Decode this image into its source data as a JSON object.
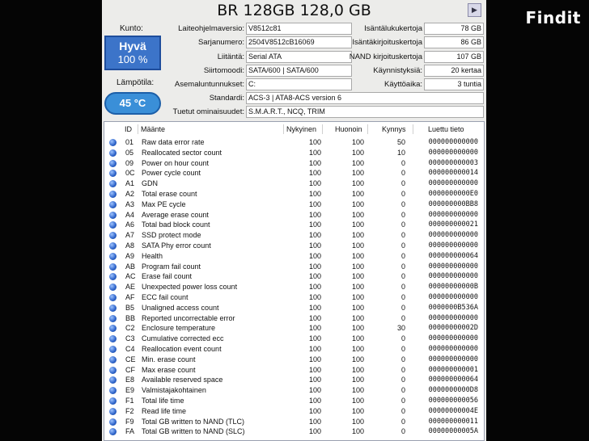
{
  "brand": "Findit",
  "title": "BR 128GB 128,0 GB",
  "left_panel": {
    "condition_label": "Kunto:",
    "condition_value": "Hyvä",
    "condition_percent": "100 %",
    "temperature_label": "Lämpötila:",
    "temperature_value": "45 °C"
  },
  "info": {
    "firmware_label": "Laiteohjelmaversio:",
    "firmware": "V8512c81",
    "serial_label": "Sarjanumero:",
    "serial": "2504V8512cB16069",
    "interface_label": "Liitäntä:",
    "interface": "Serial ATA",
    "transfer_label": "Siirtomoodi:",
    "transfer": "SATA/600 | SATA/600",
    "drive_label": "Asemaluntunnukset:",
    "drive": "C:",
    "standard_label": "Standardi:",
    "standard": "ACS-3 | ATA8-ACS version 6",
    "features_label": "Tuetut ominaisuudet:",
    "features": "S.M.A.R.T., NCQ, TRIM",
    "host_reads_label": "Isäntälukukertoja",
    "host_reads": "78 GB",
    "host_writes_label": "Isäntäkirjoituskertoja",
    "host_writes": "86 GB",
    "nand_writes_label": "NAND kirjoituskertoja",
    "nand_writes": "107 GB",
    "power_on_count_label": "Käynnistyksiä:",
    "power_on_count": "20 kertaa",
    "power_on_hours_label": "Käyttöaika:",
    "power_on_hours": "3 tuntia"
  },
  "table": {
    "headers": [
      "ID",
      "Määnte",
      "Nykyinen",
      "Huonoin",
      "Kynnys",
      "Luettu tieto"
    ],
    "rows": [
      {
        "id": "01",
        "name": "Raw data error rate",
        "cur": "100",
        "worst": "100",
        "thr": "50",
        "raw": "000000000000"
      },
      {
        "id": "05",
        "name": "Reallocated sector count",
        "cur": "100",
        "worst": "100",
        "thr": "10",
        "raw": "000000000000"
      },
      {
        "id": "09",
        "name": "Power on hour count",
        "cur": "100",
        "worst": "100",
        "thr": "0",
        "raw": "000000000003"
      },
      {
        "id": "0C",
        "name": "Power cycle count",
        "cur": "100",
        "worst": "100",
        "thr": "0",
        "raw": "000000000014"
      },
      {
        "id": "A1",
        "name": "GDN",
        "cur": "100",
        "worst": "100",
        "thr": "0",
        "raw": "000000000000"
      },
      {
        "id": "A2",
        "name": "Total erase count",
        "cur": "100",
        "worst": "100",
        "thr": "0",
        "raw": "0000000000E0"
      },
      {
        "id": "A3",
        "name": "Max PE cycle",
        "cur": "100",
        "worst": "100",
        "thr": "0",
        "raw": "000000000BB8"
      },
      {
        "id": "A4",
        "name": "Average erase count",
        "cur": "100",
        "worst": "100",
        "thr": "0",
        "raw": "000000000000"
      },
      {
        "id": "A6",
        "name": "Total bad block count",
        "cur": "100",
        "worst": "100",
        "thr": "0",
        "raw": "000000000021"
      },
      {
        "id": "A7",
        "name": "SSD protect mode",
        "cur": "100",
        "worst": "100",
        "thr": "0",
        "raw": "000000000000"
      },
      {
        "id": "A8",
        "name": "SATA Phy error count",
        "cur": "100",
        "worst": "100",
        "thr": "0",
        "raw": "000000000000"
      },
      {
        "id": "A9",
        "name": "Health",
        "cur": "100",
        "worst": "100",
        "thr": "0",
        "raw": "000000000064"
      },
      {
        "id": "AB",
        "name": "Program fail count",
        "cur": "100",
        "worst": "100",
        "thr": "0",
        "raw": "000000000000"
      },
      {
        "id": "AC",
        "name": "Erase fail count",
        "cur": "100",
        "worst": "100",
        "thr": "0",
        "raw": "000000000000"
      },
      {
        "id": "AE",
        "name": "Unexpected power loss count",
        "cur": "100",
        "worst": "100",
        "thr": "0",
        "raw": "00000000000B"
      },
      {
        "id": "AF",
        "name": "ECC fail count",
        "cur": "100",
        "worst": "100",
        "thr": "0",
        "raw": "000000000000"
      },
      {
        "id": "B5",
        "name": "Unaligned access count",
        "cur": "100",
        "worst": "100",
        "thr": "0",
        "raw": "0000000B536A"
      },
      {
        "id": "BB",
        "name": "Reported uncorrectable error",
        "cur": "100",
        "worst": "100",
        "thr": "0",
        "raw": "000000000000"
      },
      {
        "id": "C2",
        "name": "Enclosure temperature",
        "cur": "100",
        "worst": "100",
        "thr": "30",
        "raw": "00000000002D"
      },
      {
        "id": "C3",
        "name": "Cumulative corrected ecc",
        "cur": "100",
        "worst": "100",
        "thr": "0",
        "raw": "000000000000"
      },
      {
        "id": "C4",
        "name": "Reallocation event count",
        "cur": "100",
        "worst": "100",
        "thr": "0",
        "raw": "000000000000"
      },
      {
        "id": "CE",
        "name": "Min. erase count",
        "cur": "100",
        "worst": "100",
        "thr": "0",
        "raw": "000000000000"
      },
      {
        "id": "CF",
        "name": "Max erase count",
        "cur": "100",
        "worst": "100",
        "thr": "0",
        "raw": "000000000001"
      },
      {
        "id": "E8",
        "name": "Available reserved space",
        "cur": "100",
        "worst": "100",
        "thr": "0",
        "raw": "000000000064"
      },
      {
        "id": "E9",
        "name": "Valmistajakohtainen",
        "cur": "100",
        "worst": "100",
        "thr": "0",
        "raw": "0000000000D8"
      },
      {
        "id": "F1",
        "name": "Total life time",
        "cur": "100",
        "worst": "100",
        "thr": "0",
        "raw": "000000000056"
      },
      {
        "id": "F2",
        "name": "Read life time",
        "cur": "100",
        "worst": "100",
        "thr": "0",
        "raw": "00000000004E"
      },
      {
        "id": "F9",
        "name": "Total GB written to NAND (TLC)",
        "cur": "100",
        "worst": "100",
        "thr": "0",
        "raw": "000000000011"
      },
      {
        "id": "FA",
        "name": "Total GB written to NAND (SLC)",
        "cur": "100",
        "worst": "100",
        "thr": "0",
        "raw": "00000000005A"
      }
    ]
  }
}
